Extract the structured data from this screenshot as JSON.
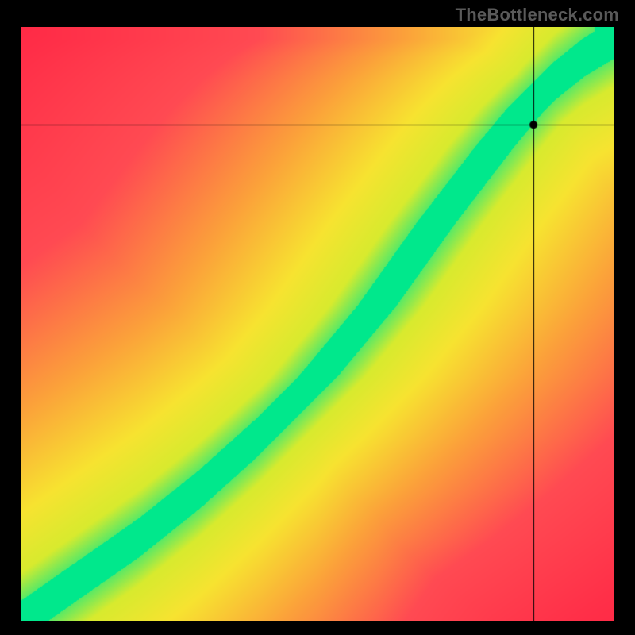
{
  "watermark": "TheBottleneck.com",
  "chart_data": {
    "type": "heatmap",
    "title": "",
    "xlabel": "",
    "ylabel": "",
    "xlim": [
      0,
      100
    ],
    "ylim": [
      0,
      100
    ],
    "crosshair": {
      "x": 86.5,
      "y": 83.5
    },
    "marker": {
      "x": 86.5,
      "y": 83.5
    },
    "ideal_curve": {
      "description": "Green optimal band center (y as function of x, 0-100 scale)",
      "x": [
        0,
        10,
        20,
        30,
        40,
        50,
        60,
        70,
        80,
        85,
        90,
        95,
        100
      ],
      "y": [
        0,
        7,
        14,
        22,
        31,
        41,
        53,
        67,
        80,
        86,
        91,
        95,
        98
      ]
    },
    "band_half_width_y": 6,
    "color_scale": {
      "description": "Distance from ideal curve mapped to color",
      "stops": [
        {
          "distance": 0,
          "color": "#00e88c"
        },
        {
          "distance": 8,
          "color": "#d8ea2e"
        },
        {
          "distance": 18,
          "color": "#f7e330"
        },
        {
          "distance": 35,
          "color": "#fba23a"
        },
        {
          "distance": 60,
          "color": "#ff4a52"
        },
        {
          "distance": 100,
          "color": "#ff2a46"
        }
      ]
    }
  }
}
